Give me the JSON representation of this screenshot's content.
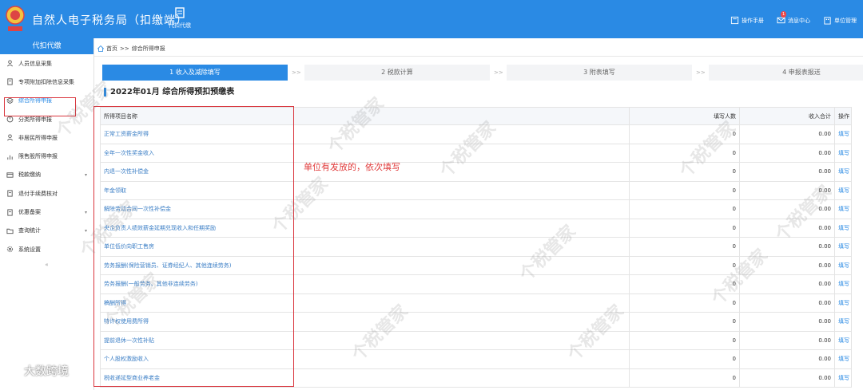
{
  "header": {
    "title": "自然人电子税务局（扣缴端）",
    "module_label": "代扣代缴",
    "right": [
      {
        "label": "操作手册",
        "icon": "book-icon"
      },
      {
        "label": "消息中心",
        "icon": "mail-icon",
        "badge": "1"
      },
      {
        "label": "单位管理",
        "icon": "building-icon"
      }
    ]
  },
  "sidebar": {
    "heading": "代扣代缴",
    "items": [
      {
        "label": "人员信息采集",
        "icon": "person-icon",
        "chevron": false
      },
      {
        "label": "专项附加扣除信息采集",
        "icon": "doc-icon",
        "chevron": false
      },
      {
        "label": "综合所得申报",
        "icon": "layers-icon",
        "chevron": false,
        "active": true
      },
      {
        "label": "分类所得申报",
        "icon": "pie-icon",
        "chevron": false
      },
      {
        "label": "非居民所得申报",
        "icon": "person-icon",
        "chevron": false
      },
      {
        "label": "限售股所得申报",
        "icon": "chart-icon",
        "chevron": false
      },
      {
        "label": "税款缴纳",
        "icon": "card-icon",
        "chevron": true
      },
      {
        "label": "退付手续费核对",
        "icon": "doc-icon",
        "chevron": false
      },
      {
        "label": "优惠备案",
        "icon": "doc-icon",
        "chevron": true
      },
      {
        "label": "查询统计",
        "icon": "folder-icon",
        "chevron": true
      },
      {
        "label": "系统设置",
        "icon": "gear-icon",
        "chevron": false
      }
    ],
    "collapse": "«"
  },
  "breadcrumb": {
    "home": "首页",
    "sep": ">>",
    "current": "综合所得申报"
  },
  "steps": [
    {
      "label": "1 收入及减除填写",
      "active": true
    },
    {
      "label": "2 税款计算",
      "active": false
    },
    {
      "label": "3 附表填写",
      "active": false
    },
    {
      "label": "4 申报表报送",
      "active": false
    }
  ],
  "step_arrow": ">>",
  "form_title": "2022年01月  综合所得预扣预缴表",
  "table": {
    "headers": [
      "所得项目名称",
      "填写人数",
      "收入合计",
      "操作"
    ],
    "rows": [
      {
        "name": "正常工资薪金所得",
        "count": "0",
        "income": "0.00",
        "op": "填写"
      },
      {
        "name": "全年一次性奖金收入",
        "count": "0",
        "income": "0.00",
        "op": "填写"
      },
      {
        "name": "内退一次性补偿金",
        "count": "0",
        "income": "0.00",
        "op": "填写"
      },
      {
        "name": "年金领取",
        "count": "0",
        "income": "0.00",
        "op": "填写"
      },
      {
        "name": "解除劳动合同一次性补偿金",
        "count": "0",
        "income": "0.00",
        "op": "填写"
      },
      {
        "name": "央企负责人绩效薪金延期兑现收入和任期奖励",
        "count": "0",
        "income": "0.00",
        "op": "填写"
      },
      {
        "name": "单位低价向职工售房",
        "count": "0",
        "income": "0.00",
        "op": "填写"
      },
      {
        "name": "劳务报酬(保险营销员、证券经纪人、其他连续劳务)",
        "count": "0",
        "income": "0.00",
        "op": "填写"
      },
      {
        "name": "劳务报酬(一般劳务、其他非连续劳务)",
        "count": "0",
        "income": "0.00",
        "op": "填写"
      },
      {
        "name": "稿酬所得",
        "count": "0",
        "income": "0.00",
        "op": "填写"
      },
      {
        "name": "特许权使用费所得",
        "count": "0",
        "income": "0.00",
        "op": "填写"
      },
      {
        "name": "提前退休一次性补贴",
        "count": "0",
        "income": "0.00",
        "op": "填写"
      },
      {
        "name": "个人股权激励收入",
        "count": "0",
        "income": "0.00",
        "op": "填写"
      },
      {
        "name": "税收递延型商业养老金",
        "count": "0",
        "income": "0.00",
        "op": "填写"
      }
    ]
  },
  "annotation": "单位有发放的，依次填写",
  "watermark": "个税管家",
  "corner_watermark": "大数跨境",
  "colors": {
    "primary": "#2a8ae4",
    "annotation_red": "#d9363e"
  }
}
